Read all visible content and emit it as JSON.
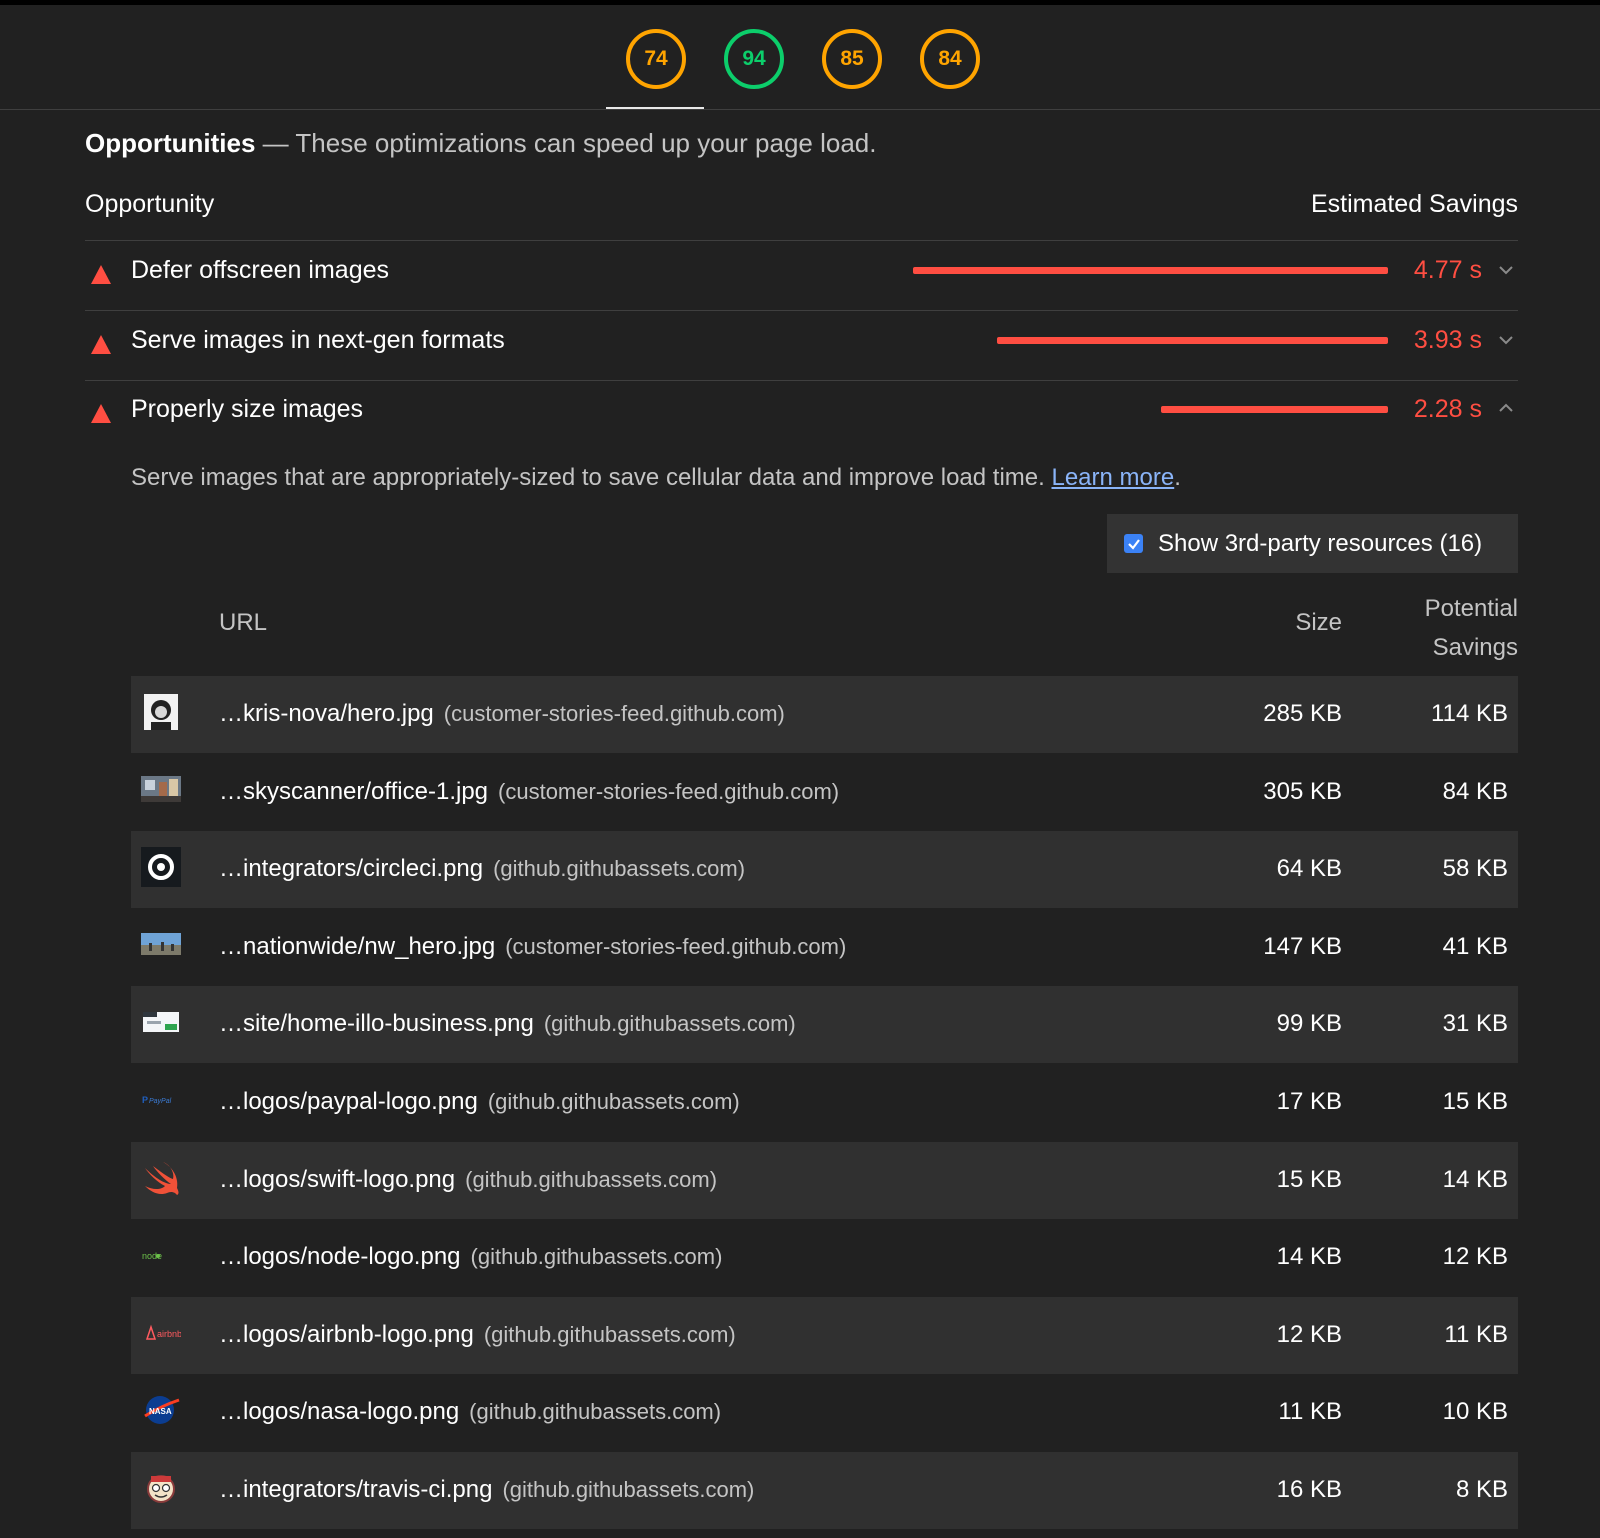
{
  "scores": [
    "74",
    "94",
    "85",
    "84"
  ],
  "section": {
    "title": "Opportunities",
    "dash": " — ",
    "description": "These optimizations can speed up your page load."
  },
  "columns": {
    "opportunity": "Opportunity",
    "savings": "Estimated Savings"
  },
  "audits": [
    {
      "label": "Defer offscreen images",
      "value": "4.77 s",
      "seconds": 4.77,
      "expanded": false
    },
    {
      "label": "Serve images in next-gen formats",
      "value": "3.93 s",
      "seconds": 3.93,
      "expanded": false
    },
    {
      "label": "Properly size images",
      "value": "2.28 s",
      "seconds": 2.28,
      "expanded": true
    }
  ],
  "details": {
    "help_text": "Serve images that are appropriately-sized to save cellular data and improve load time. ",
    "learn_more": "Learn more",
    "period": ".",
    "third_party_label": "Show 3rd-party resources (16)",
    "third_party_checked": true,
    "headers": {
      "url": "URL",
      "size": "Size",
      "savings_1": "Potential",
      "savings_2": "Savings"
    },
    "rows": [
      {
        "thumb": "portrait-thumb-icon",
        "url": "…kris-nova/hero.jpg",
        "host": "(customer-stories-feed.github.com)",
        "size": "285 KB",
        "savings": "114 KB"
      },
      {
        "thumb": "office-photo-thumb-icon",
        "url": "…skyscanner/office-1.jpg",
        "host": "(customer-stories-feed.github.com)",
        "size": "305 KB",
        "savings": "84 KB"
      },
      {
        "thumb": "circleci-logo-icon",
        "url": "…integrators/circleci.png",
        "host": "(github.githubassets.com)",
        "size": "64 KB",
        "savings": "58 KB"
      },
      {
        "thumb": "landscape-photo-thumb-icon",
        "url": "…nationwide/nw_hero.jpg",
        "host": "(customer-stories-feed.github.com)",
        "size": "147 KB",
        "savings": "41 KB"
      },
      {
        "thumb": "business-illustration-thumb-icon",
        "url": "…site/home-illo-business.png",
        "host": "(github.githubassets.com)",
        "size": "99 KB",
        "savings": "31 KB"
      },
      {
        "thumb": "paypal-logo-icon",
        "url": "…logos/paypal-logo.png",
        "host": "(github.githubassets.com)",
        "size": "17 KB",
        "savings": "15 KB"
      },
      {
        "thumb": "swift-logo-icon",
        "url": "…logos/swift-logo.png",
        "host": "(github.githubassets.com)",
        "size": "15 KB",
        "savings": "14 KB"
      },
      {
        "thumb": "node-logo-icon",
        "url": "…logos/node-logo.png",
        "host": "(github.githubassets.com)",
        "size": "14 KB",
        "savings": "12 KB"
      },
      {
        "thumb": "airbnb-logo-icon",
        "url": "…logos/airbnb-logo.png",
        "host": "(github.githubassets.com)",
        "size": "12 KB",
        "savings": "11 KB"
      },
      {
        "thumb": "nasa-logo-icon",
        "url": "…logos/nasa-logo.png",
        "host": "(github.githubassets.com)",
        "size": "11 KB",
        "savings": "10 KB"
      },
      {
        "thumb": "travis-ci-logo-icon",
        "url": "…integrators/travis-ci.png",
        "host": "(github.githubassets.com)",
        "size": "16 KB",
        "savings": "8 KB"
      }
    ]
  },
  "colors": {
    "background": "#212121",
    "fail": "#ff4e42",
    "average": "#ffa400",
    "pass": "#0cce6b",
    "link": "#8ab4f8",
    "checkbox": "#3b82f6"
  }
}
